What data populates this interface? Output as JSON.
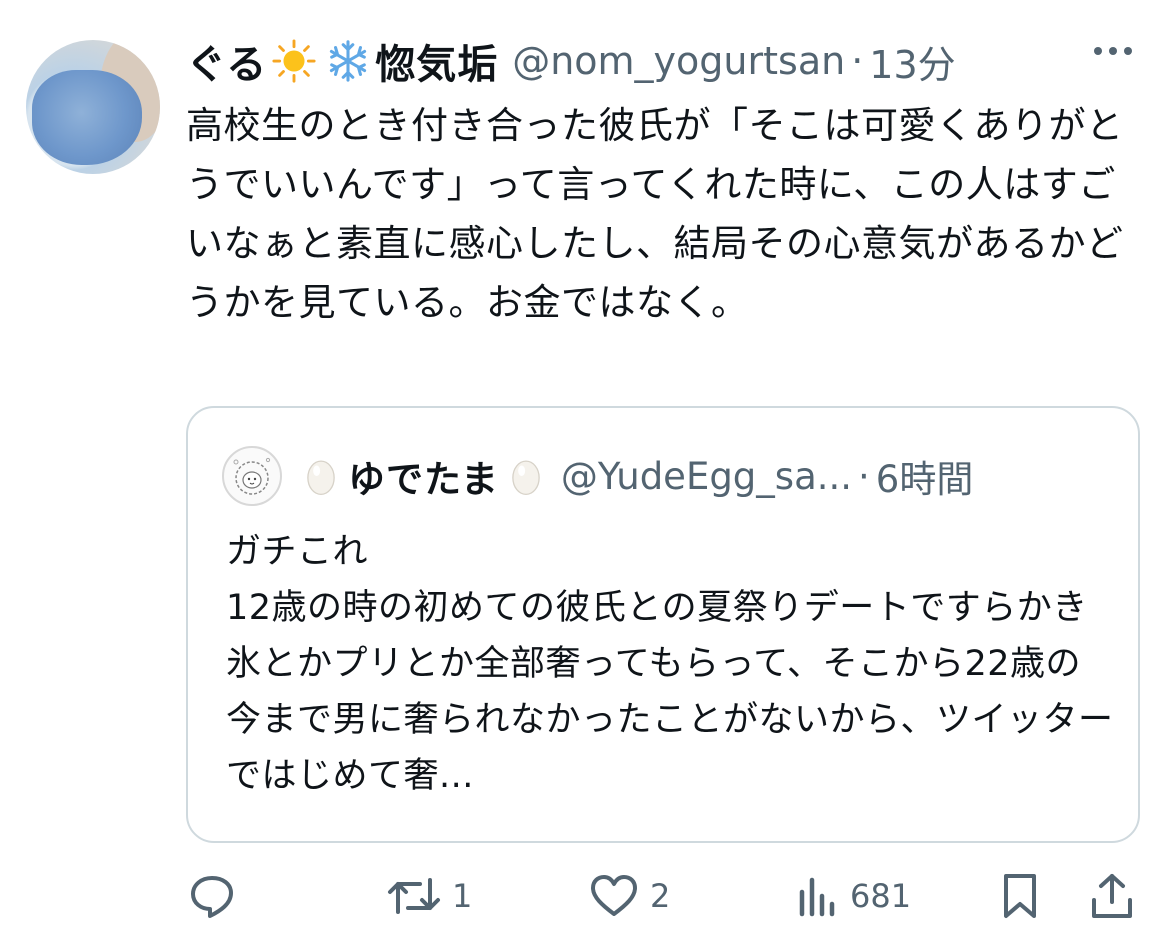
{
  "tweet": {
    "author_name": "ぐる",
    "author_name_suffix": "惚気垢",
    "name_emojis": [
      "sun-emoji",
      "snowflake-emoji"
    ],
    "handle": "@nom_yogurtsan",
    "separator": "·",
    "time": "13分",
    "text": "高校生のとき付き合った彼氏が「そこは可愛くありがとうでいいんです」って言ってくれた時に、この人はすごいなぁと素直に感心したし、結局その心意気があるかどうかを見ている。お金ではなく。"
  },
  "quote": {
    "author_name": "ゆでたま",
    "name_emojis": [
      "egg-emoji",
      "egg-emoji"
    ],
    "handle": "@YudeEgg_sa...",
    "separator": "·",
    "time": "6時間",
    "text": "ガチこれ\n12歳の時の初めての彼氏との夏祭りデートですらかき氷とかプリとか全部奢ってもらって、そこから22歳の今まで男に奢られなかったことがないから、ツイッターではじめて奢..."
  },
  "actions": {
    "reply_count": "",
    "retweet_count": "1",
    "like_count": "2",
    "views_count": "681"
  },
  "colors": {
    "text": "#0f1419",
    "secondary": "#536471",
    "border": "#cfd9de"
  }
}
